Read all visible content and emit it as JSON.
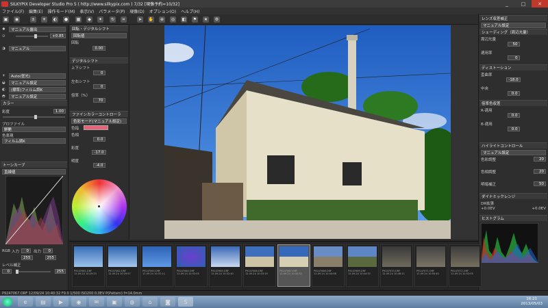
{
  "window": {
    "title": "SILKYPIX Developer Studio Pro 5 ( http://www.silkypix.com ) 7/32 [現像予約=10/32]",
    "controls": [
      "_",
      "□",
      "✕"
    ]
  },
  "menu": [
    "ファイル(F)",
    "編集(E)",
    "操作モード(M)",
    "表示(V)",
    "パラメータ(P)",
    "現像(D)",
    "オプション(O)",
    "ヘルプ(H)"
  ],
  "left": {
    "items": [
      {
        "label": "マニュアル露出",
        "value": "+0.85"
      },
      {
        "label": "マニュアル"
      },
      {
        "label": "Auto(昼光)"
      },
      {
        "label": "マニュアル設定"
      },
      {
        "label": "(標準)フィルム調K"
      },
      {
        "label": "マニュアル設定"
      }
    ],
    "color_header": "カラー",
    "saturation_label": "彩度",
    "saturation_value": "1.00",
    "profile_label": "プロファイル",
    "profile_value": "鮮艶",
    "color_label": "色表現",
    "color_value": "フィルム調K",
    "tone_header": "トーンカーブ",
    "tone_value": "直線値",
    "rgb_label": "RGB",
    "input_label": "入力",
    "output_label": "出力",
    "input_value": "0",
    "output_value": "0",
    "input_max": "255",
    "output_max": "255",
    "level_label": "レベル補正"
  },
  "mid": {
    "rotate_header": "回転・デジタルシフト",
    "rotate_value": "回転値",
    "rotate_label": "回転",
    "rotate_num": "0.00",
    "shift_header": "デジタルシフト",
    "shift_up": "上下シフト",
    "shift_lr": "左右シフト",
    "shift_zoom": "倍率（%）",
    "shift_values": [
      "0",
      "0",
      "70"
    ],
    "fine_header": "ファインカラーコントローラ",
    "fine_value": "色彩モード(マニュアル設定)",
    "fine_label": "色指",
    "hue_label": "色相",
    "hue_value": "0.0",
    "sat_label": "彩度",
    "sat_value": "-17.0",
    "bright_label": "明度",
    "bright_value": "-4.0"
  },
  "right": {
    "lens_header": "レンズ収差補正",
    "lens_value": "マニュアル設定",
    "sharp_header": "シェーディング（周辺光量）",
    "sharp_labels": [
      "周辺光量",
      "適用率"
    ],
    "sharp_values": [
      "50",
      "0"
    ],
    "dist_header": "ディストーション",
    "dist_labels": [
      "歪曲率",
      "中央"
    ],
    "dist_values": [
      "-18.0",
      "0.0"
    ],
    "chrom_header": "倍率色収差",
    "chrom_labels": [
      "R-適用",
      "B-適用"
    ],
    "chrom_values": [
      "0.0",
      "0.0"
    ],
    "hl_header": "ハイライトコントロール",
    "hl_value": "マニュアル設定",
    "hl_labels": [
      "色彩調整",
      "色相調整",
      "明暗補正"
    ],
    "hl_values": [
      "20",
      "20",
      "50"
    ],
    "dr_header": "ダイナミックレンジ",
    "dr_label": "DR拡張",
    "dr_left": "+0.0EV",
    "dr_right": "+0.0EV",
    "hist_header": "ヒストグラム"
  },
  "filmstrip": [
    {
      "name": "P9247061.ORF",
      "caption": "12-09-24 10:29:23"
    },
    {
      "name": "P9247062.ORF",
      "caption": "12-09-24 10:29:57"
    },
    {
      "name": "P9247063.ORF",
      "caption": "12-09-24 10:31:11"
    },
    {
      "name": "P9247064.ORF",
      "caption": "12-09-24 10:32:05"
    },
    {
      "name": "P9247065.ORF",
      "caption": "12-09-24 10:32:40"
    },
    {
      "name": "P9247066.ORF",
      "caption": "12-09-24 10:33:19"
    },
    {
      "name": "P9247067.ORF",
      "caption": "12-09-24 10:40:32"
    },
    {
      "name": "P9247068.ORF",
      "caption": "12-09-24 10:44:08"
    },
    {
      "name": "P9247069.ORF",
      "caption": "12-09-24 10:44:33"
    },
    {
      "name": "P9247070.ORF",
      "caption": "12-09-24 10:46:11"
    },
    {
      "name": "P9247071.ORF",
      "caption": "12-09-24 10:50:40"
    },
    {
      "name": "P9247072.ORF",
      "caption": "12-09-24 10:52:05"
    },
    {
      "name": "P9247073.ORF",
      "caption": "12-09-24 10:53:34"
    }
  ],
  "status": "P9247067.ORF 12/09/24 10:40:32 F9.0 1/500 ISO200 0.0EV P(Pattern) f=14.0mm",
  "taskbar": {
    "time": "16:21",
    "date": "2013/05/03"
  },
  "colors": {
    "sky": "#2f6fd1",
    "accent": "#e8637a"
  }
}
